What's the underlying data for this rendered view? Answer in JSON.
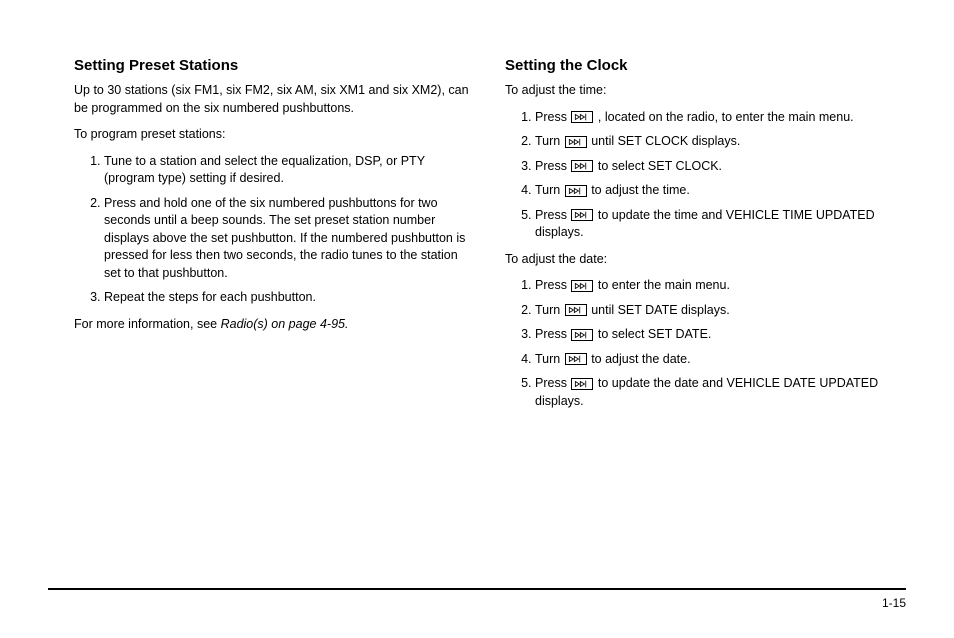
{
  "left": {
    "heading": "Setting Preset Stations",
    "intro": "Up to 30 stations (six FM1, six FM2, six AM, six XM1 and six XM2), can be programmed on the six numbered pushbuttons.",
    "lead": "To program preset stations:",
    "steps": [
      "Tune to a station and select the equalization, DSP, or PTY (program type) setting if desired.",
      "Press and hold one of the six numbered pushbuttons for two seconds until a beep sounds. The set preset station number displays above the set pushbutton. If the numbered pushbutton is pressed for less then two seconds, the radio tunes to the station set to that pushbutton.",
      "Repeat the steps for each pushbutton."
    ],
    "closing_pre": "For more information, see ",
    "closing_ref": "Radio(s) on page 4-95.",
    "closing_post": ""
  },
  "right": {
    "heading": "Setting the Clock",
    "time_lead": "To adjust the time:",
    "time_steps": [
      {
        "pre": "Press ",
        "icon": "menu-button-icon",
        "post": " , located on the radio, to enter the main menu."
      },
      {
        "pre": "Turn ",
        "icon": "tune-knob-icon",
        "post": " until SET CLOCK displays."
      },
      {
        "pre": "Press ",
        "icon": "menu-button-icon",
        "post": " to select SET CLOCK."
      },
      {
        "pre": "Turn ",
        "icon": "tune-knob-icon",
        "post": " to adjust the time."
      },
      {
        "pre": "Press ",
        "icon": "menu-button-icon",
        "post": " to update the time and VEHICLE TIME UPDATED displays."
      }
    ],
    "date_lead": "To adjust the date:",
    "date_steps": [
      {
        "pre": "Press ",
        "icon": "menu-button-icon",
        "post": " to enter the main menu."
      },
      {
        "pre": "Turn ",
        "icon": "tune-knob-icon",
        "post": " until SET DATE displays."
      },
      {
        "pre": "Press ",
        "icon": "menu-button-icon",
        "post": " to select SET DATE."
      },
      {
        "pre": "Turn ",
        "icon": "tune-knob-icon",
        "post": " to adjust the date."
      },
      {
        "pre": "Press ",
        "icon": "menu-button-icon",
        "post": " to update the date and VEHICLE DATE UPDATED displays."
      }
    ]
  },
  "pagenum": "1-15"
}
